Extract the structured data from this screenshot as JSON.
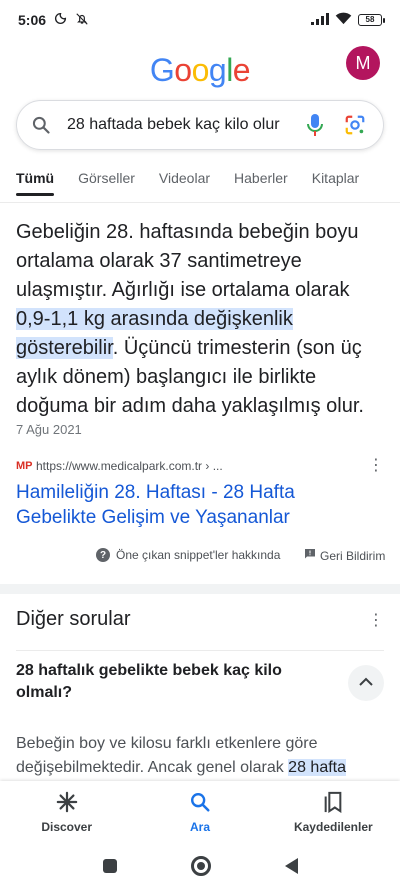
{
  "status_bar": {
    "time": "5:06",
    "battery": "58"
  },
  "header": {
    "logo": [
      "G",
      "o",
      "o",
      "g",
      "l",
      "e"
    ],
    "logo_colors": [
      "#4285F4",
      "#EA4335",
      "#FBBC05",
      "#4285F4",
      "#34A853",
      "#EA4335"
    ],
    "avatar_letter": "M",
    "avatar_color": "#B3155E"
  },
  "search": {
    "query": "28 haftada bebek kaç kilo olur"
  },
  "tabs": [
    {
      "label": "Tümü"
    },
    {
      "label": "Görseller"
    },
    {
      "label": "Videolar"
    },
    {
      "label": "Haberler"
    },
    {
      "label": "Kitaplar"
    }
  ],
  "snippet": {
    "text_before": "Gebeliğin 28. haftasında bebeğin boyu ortalama olarak 37 santimetreye ulaşmıştır. Ağırlığı ise ortalama olarak ",
    "text_highlight": "0,9-1,1 kg arasında değişkenlik gösterebilir",
    "text_after": ". Üçüncü trimesterin (son üç aylık dönem) başlangıcı ile birlikte doğuma bir adım daha yaklaşılmış olur.",
    "date": "7 Ağu 2021",
    "source_icon_text": "MP",
    "source_url": "https://www.medicalpark.com.tr › ...",
    "link_title": "Hamileliğin 28. Haftası - 28 Hafta Gebelikte Gelişim ve Yaşananlar",
    "about_label": "Öne çıkan snippet'ler hakkında",
    "feedback_label": "Geri Bildirim"
  },
  "other_questions": {
    "title": "Diğer sorular",
    "question": "28 haftalık gebelikte bebek kaç kilo olmalı?",
    "answer_before": "Bebeğin boy ve kilosu farklı etkenlere göre değişebilmektedir. Ancak genel olarak ",
    "answer_highlight": "28 hafta"
  },
  "bottom_nav": [
    {
      "label": "Discover",
      "icon": "asterisk-icon"
    },
    {
      "label": "Ara",
      "icon": "search-icon"
    },
    {
      "label": "Kaydedilenler",
      "icon": "bookmarks-icon"
    }
  ]
}
